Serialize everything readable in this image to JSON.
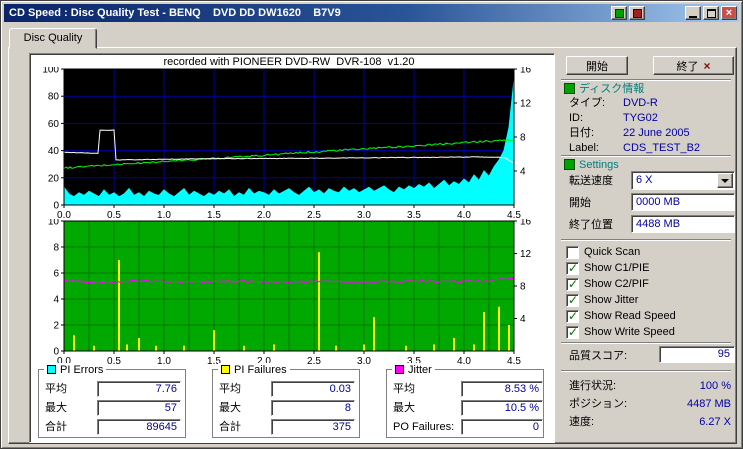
{
  "window": {
    "title": "CD Speed : Disc Quality Test - BENQ    DVD DD DW1620    B7V9"
  },
  "icons": {
    "close": "×",
    "exit": "×",
    "minimize": "css-bar",
    "maximize": "css-box",
    "dropdown_arrow": "css-triangle",
    "section_collapse": "css-green-box"
  },
  "tabs": {
    "disc_quality": "Disc Quality"
  },
  "chart_data": {
    "type": "line",
    "title": "recorded with PIONEER DVD-RW  DVR-108  v1.20",
    "x_min": 0,
    "x_max": 4.5,
    "x_unit": "GB",
    "x_ticks": [
      0,
      0.5,
      1,
      1.5,
      2,
      2.5,
      3,
      3.5,
      4,
      4.5
    ],
    "x_tick_labels": [
      "0.0",
      "0.5",
      "1.0",
      "1.5",
      "2.0",
      "2.5",
      "3.0",
      "3.5",
      "4.0",
      "4.5"
    ],
    "top": {
      "bg": "#000000",
      "grid": "#0000A8",
      "grid_x_step": 0.5,
      "left_axis": {
        "min": 0,
        "max": 100,
        "ticks": [
          0,
          20,
          40,
          60,
          80,
          100
        ]
      },
      "right_axis": {
        "min": 0,
        "max": 16,
        "ticks": [
          4,
          8,
          12,
          16
        ]
      },
      "series": [
        {
          "name": "pi-errors",
          "color": "#00FFFF",
          "style": "area",
          "axis": "left",
          "x_start": 0,
          "x_step": 0.05,
          "values": [
            13,
            8,
            6,
            9,
            7,
            10,
            8,
            6,
            11,
            7,
            9,
            6,
            8,
            12,
            7,
            9,
            6,
            10,
            8,
            7,
            11,
            8,
            6,
            9,
            12,
            7,
            10,
            8,
            6,
            9,
            7,
            10,
            8,
            11,
            6,
            9,
            7,
            12,
            8,
            10,
            9,
            7,
            11,
            8,
            10,
            12,
            9,
            7,
            10,
            13,
            9,
            11,
            8,
            12,
            10,
            9,
            13,
            10,
            12,
            9,
            11,
            13,
            10,
            12,
            14,
            11,
            9,
            13,
            11,
            14,
            12,
            15,
            13,
            16,
            12,
            15,
            18,
            14,
            17,
            15,
            19,
            16,
            22,
            18,
            25,
            21,
            28,
            33,
            40,
            57,
            92
          ]
        },
        {
          "name": "write-speed",
          "color": "#00FF00",
          "style": "line",
          "axis": "right",
          "noise": 0.22,
          "points": [
            [
              0,
              4.35
            ],
            [
              0.5,
              4.75
            ],
            [
              1,
              5.1
            ],
            [
              1.5,
              5.5
            ],
            [
              2,
              5.85
            ],
            [
              2.5,
              6.25
            ],
            [
              3,
              6.6
            ],
            [
              3.5,
              6.95
            ],
            [
              4,
              7.35
            ],
            [
              4.5,
              7.65
            ]
          ]
        },
        {
          "name": "read-speed",
          "color": "#FFFFFF",
          "style": "line",
          "axis": "right",
          "noise": 0.07,
          "points": [
            [
              0,
              6.2
            ],
            [
              0.15,
              6.15
            ],
            [
              0.3,
              6.1
            ],
            [
              0.34,
              6.05
            ],
            [
              0.36,
              8.8
            ],
            [
              0.5,
              8.8
            ],
            [
              0.52,
              5.3
            ],
            [
              0.8,
              5.35
            ],
            [
              1.5,
              5.45
            ],
            [
              2.5,
              5.5
            ],
            [
              3.5,
              5.6
            ],
            [
              4.2,
              5.65
            ],
            [
              4.4,
              5.6
            ],
            [
              4.5,
              4.9
            ]
          ]
        }
      ]
    },
    "bottom": {
      "bg": "#00A800",
      "grid": "#007800",
      "grid_x_step": 0.25,
      "left_axis": {
        "min": 0,
        "max": 10,
        "ticks": [
          0,
          2,
          4,
          6,
          8,
          10
        ]
      },
      "right_axis": {
        "min": 0,
        "max": 16,
        "ticks": [
          4,
          8,
          12,
          16
        ]
      },
      "series": [
        {
          "name": "pi-failures",
          "color": "#FFFF00",
          "style": "bars",
          "axis": "left",
          "points": [
            [
              0.1,
              1.2
            ],
            [
              0.3,
              0.4
            ],
            [
              0.55,
              7.0
            ],
            [
              0.63,
              0.5
            ],
            [
              0.75,
              1.0
            ],
            [
              0.92,
              0.4
            ],
            [
              1.2,
              0.4
            ],
            [
              1.5,
              1.6
            ],
            [
              1.8,
              0.4
            ],
            [
              2.1,
              0.5
            ],
            [
              2.55,
              7.6
            ],
            [
              2.72,
              0.4
            ],
            [
              3.0,
              0.5
            ],
            [
              3.1,
              2.6
            ],
            [
              3.42,
              0.4
            ],
            [
              3.7,
              0.5
            ],
            [
              3.9,
              1.0
            ],
            [
              4.1,
              0.5
            ],
            [
              4.2,
              3.0
            ],
            [
              4.35,
              3.4
            ],
            [
              4.45,
              2.0
            ]
          ]
        },
        {
          "name": "jitter",
          "color": "#FF00FF",
          "style": "line",
          "axis": "right",
          "noise": 0.28,
          "points": [
            [
              0,
              8.7
            ],
            [
              0.2,
              8.5
            ],
            [
              0.5,
              8.45
            ],
            [
              0.75,
              8.6
            ],
            [
              1,
              8.5
            ],
            [
              1.25,
              8.45
            ],
            [
              1.5,
              8.55
            ],
            [
              1.75,
              8.6
            ],
            [
              2,
              8.5
            ],
            [
              2.25,
              8.45
            ],
            [
              2.5,
              8.6
            ],
            [
              2.75,
              8.5
            ],
            [
              3,
              8.45
            ],
            [
              3.25,
              8.55
            ],
            [
              3.5,
              8.6
            ],
            [
              3.75,
              8.5
            ],
            [
              4,
              8.55
            ],
            [
              4.25,
              8.65
            ],
            [
              4.4,
              9.0
            ],
            [
              4.5,
              8.8
            ]
          ]
        }
      ]
    }
  },
  "stats": {
    "pi_errors": {
      "title": "PI Errors",
      "swatch_style": "background:#00FFFF",
      "rows": [
        {
          "label": "平均",
          "value": "7.76"
        },
        {
          "label": "最大",
          "value": "57"
        },
        {
          "label": "合計",
          "value": "89645"
        }
      ]
    },
    "pi_failures": {
      "title": "PI Failures",
      "swatch_style": "background:#FFFF00",
      "rows": [
        {
          "label": "平均",
          "value": "0.03"
        },
        {
          "label": "最大",
          "value": "8"
        },
        {
          "label": "合計",
          "value": "375"
        }
      ]
    },
    "jitter": {
      "title": "Jitter",
      "swatch_style": "background:#FF00FF",
      "rows": [
        {
          "label": "平均",
          "value": "8.53 %"
        },
        {
          "label": "最大",
          "value": "10.5 %"
        },
        {
          "label": "PO Failures:",
          "value": "0"
        }
      ]
    }
  },
  "side": {
    "start_button": "開始",
    "exit_button": "終了",
    "disc_info": {
      "header": "ディスク情報",
      "rows": [
        {
          "label": "タイプ:",
          "value": "DVD-R"
        },
        {
          "label": "ID:",
          "value": "TYG02"
        },
        {
          "label": "日付:",
          "value": "22 June 2005"
        },
        {
          "label": "Label:",
          "value": "CDS_TEST_B2"
        }
      ]
    },
    "settings": {
      "header": "Settings",
      "speed_label": "転送速度",
      "speed_value": "6 X",
      "start_label": "開始",
      "start_value": "0000 MB",
      "end_label": "終了位置",
      "end_value": "4488 MB",
      "checkboxes": [
        {
          "label": "Quick Scan",
          "checked": false
        },
        {
          "label": "Show C1/PIE",
          "checked": true
        },
        {
          "label": "Show C2/PIF",
          "checked": true
        },
        {
          "label": "Show Jitter",
          "checked": true
        },
        {
          "label": "Show Read Speed",
          "checked": true
        },
        {
          "label": "Show Write Speed",
          "checked": true
        }
      ]
    },
    "quality_score": {
      "label": "品質スコア:",
      "value": "95"
    },
    "status_rows": [
      {
        "label": "進行状況:",
        "value": "100 %"
      },
      {
        "label": "ポジション:",
        "value": "4487 MB"
      },
      {
        "label": "速度:",
        "value": "6.27 X"
      }
    ]
  }
}
